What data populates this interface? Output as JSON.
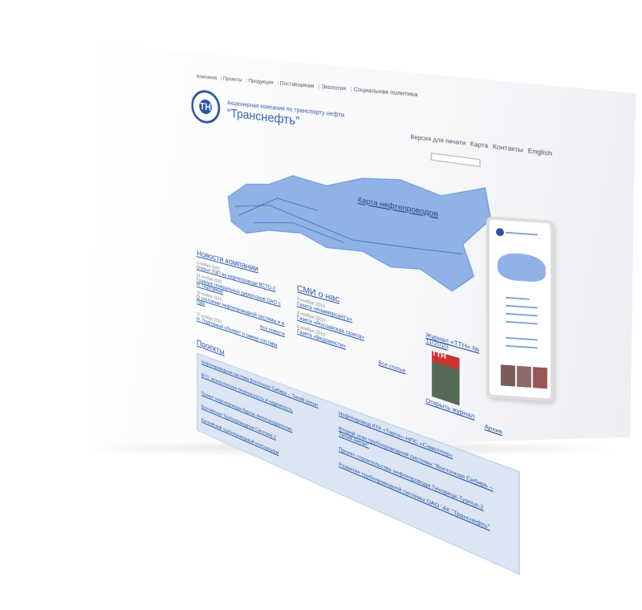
{
  "site": {
    "nav": [
      "Компания",
      "Проекты",
      "Продукция",
      "Поставщикам",
      "Экология",
      "Социальная политика"
    ],
    "company_sub": "Акционерная компания по транспорту нефти",
    "company_name": "“Транснефть”",
    "logo_text": "ТН",
    "top_links": [
      "Версия для печати",
      "Карта",
      "Контакты",
      "English"
    ],
    "map_label": "Карта нефтепроводов",
    "news": {
      "title": "Новости компании",
      "items": [
        {
          "date": "3 ноября 2010",
          "text": "Открыт ЛЭП на нефтепроводе ВСТО-2"
        },
        {
          "date": "24 ноября 2010",
          "text": "Главные генеральных директоров ОАО с Н. Подгорный"
        },
        {
          "date": "19 ноября 2010",
          "text": "О состоянии нефтепроводной системы и в года"
        },
        {
          "date": "27 ноября 2010",
          "text": "Н. Подгорный объявит о смене состава"
        }
      ],
      "more": "Все новости"
    },
    "media": {
      "title": "СМИ о нас",
      "items": [
        {
          "date": "3 ноября 2010",
          "text": "Газета «Коммерсантъ»"
        },
        {
          "date": "3 ноября 2010",
          "text": "Газета «Российская газета»"
        },
        {
          "date": "8 ноября 2010",
          "text": "Газета «Ведомости»"
        }
      ],
      "more": "Все статьи"
    },
    "journal": {
      "title": "Журнал «ТТН» № 11/2010",
      "cover_text": "ТТН",
      "link": "Открыть журнал",
      "more": "Архив"
    },
    "projects": {
      "title": "Проекты",
      "items": [
        "Нефтепроводная система Восточная Сибирь – Тихий океан",
        "Нефтепровод КТК «Тарта»–НПС «Самотлор»",
        "ВТС: экологическая безопасность и надежность",
        "Второй этап трубопроводной системы “Восточная Сибирь – Тихий океан”",
        "Проект нефтепровода Бургас-Александруполис",
        "Проект строительства нефтепровода Тихорецк-Туапсе-2",
        "Балтийская Трубопроводная Система 2",
        "Развитие трубопроводной системы ОАО “АК “Транснефть”",
        "Каспийский трубопроводный консорциум"
      ]
    }
  },
  "colors": {
    "accent": "#2a55a5",
    "map": "#8fb3e6",
    "projects_bg": "#dbe5f3"
  }
}
